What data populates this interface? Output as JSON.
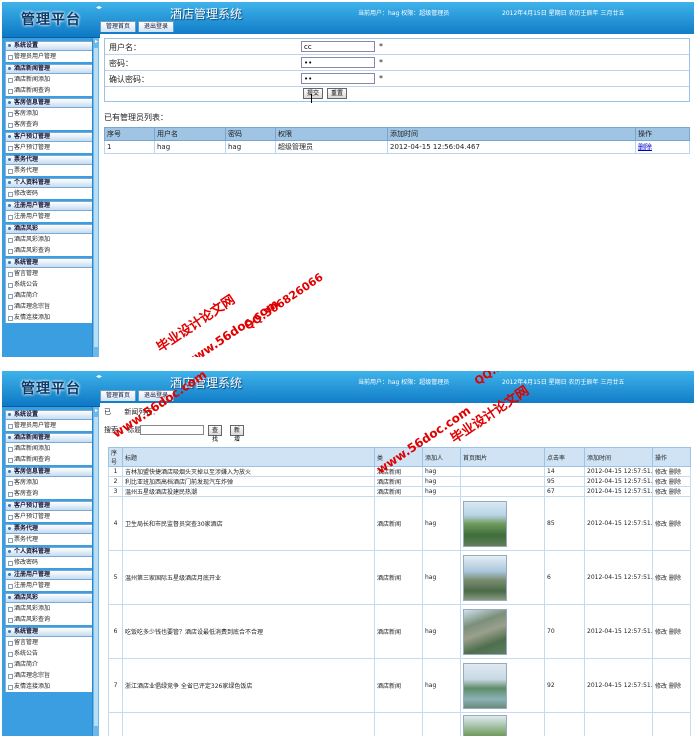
{
  "header": {
    "logo": "管理平台",
    "system_title": "酒店管理系统",
    "user_info": "当前用户：hag 权限：超级管理员",
    "date": "2012年4月15日 星期日 农历壬辰年 三月廿五",
    "collapse_glyph": "◂▸"
  },
  "tabs1": [
    "管理首页",
    "退出登录"
  ],
  "tabs2": [
    "管理首页",
    "退出登录"
  ],
  "sidebar1": [
    {
      "title": "系统设置",
      "items": [
        "管理员用户管理"
      ]
    },
    {
      "title": "酒店新闻管理",
      "items": [
        "酒店新闻添加",
        "酒店新闻查询"
      ]
    },
    {
      "title": "客房信息管理",
      "items": [
        "客房添加",
        "客房查询"
      ]
    },
    {
      "title": "客户预订管理",
      "items": [
        "客户预订管理"
      ]
    },
    {
      "title": "票务代理",
      "items": [
        "票务代理"
      ]
    },
    {
      "title": "个人资料管理",
      "items": [
        "修改密码"
      ]
    },
    {
      "title": "注册用户管理",
      "items": [
        "注册用户管理"
      ]
    },
    {
      "title": "酒店风彩",
      "items": [
        "酒店风彩添加",
        "酒店风彩查询"
      ]
    },
    {
      "title": "系统管理",
      "items": [
        "留言管理",
        "系统公告",
        "酒店简介",
        "酒店理念宗旨",
        "友情连接添加"
      ]
    }
  ],
  "sidebar2": [
    {
      "title": "系统设置",
      "items": [
        "管理员用户管理"
      ]
    },
    {
      "title": "酒店新闻管理",
      "items": [
        "酒店新闻添加",
        "酒店新闻查询"
      ]
    },
    {
      "title": "客房信息管理",
      "items": [
        "客房添加",
        "客房查询"
      ]
    },
    {
      "title": "客户预订管理",
      "items": [
        "客户预订管理"
      ]
    },
    {
      "title": "票务代理",
      "items": [
        "票务代理"
      ]
    },
    {
      "title": "个人资料管理",
      "items": [
        "修改密码"
      ]
    },
    {
      "title": "注册用户管理",
      "items": [
        "注册用户管理"
      ]
    },
    {
      "title": "酒店风彩",
      "items": [
        "酒店风彩添加",
        "酒店风彩查询"
      ]
    },
    {
      "title": "系统管理",
      "items": [
        "留言管理",
        "系统公告",
        "酒店简介",
        "酒店理念宗旨",
        "友情连接添加"
      ]
    }
  ],
  "admin_form": {
    "username_label": "用户名：",
    "username_value": "cc",
    "password_label": "密码：",
    "password_value": "••",
    "confirm_label": "确认密码：",
    "confirm_value": "••",
    "required_mark": "*",
    "submit_label": "提交",
    "reset_label": "重置"
  },
  "admin_list": {
    "title": "已有管理员列表：",
    "headers": [
      "序号",
      "用户名",
      "密码",
      "权限",
      "添加时间",
      "操作"
    ],
    "rows": [
      {
        "no": "1",
        "username": "hag",
        "password": "hag",
        "role": "超级管理员",
        "time": "2012-04-15 12:56:04.467",
        "action": "删除"
      }
    ]
  },
  "news_list": {
    "caption_prefix": "已",
    "caption_suffix": "新闻列表：",
    "search_label": "搜索：",
    "title_label": "标题：",
    "search_button": "查找",
    "add_button": "新增",
    "headers": [
      "序号",
      "标题",
      "类",
      "添加人",
      "首页图片",
      "点击率",
      "添加时间",
      "操作"
    ],
    "edit_label": "修改",
    "delete_label": "删除",
    "rows": [
      {
        "no": "1",
        "title": "吉林加盟快捷酒店吸烟头灭掉以至涉嫌入为放火",
        "type": "酒店新闻",
        "by": "hag",
        "img": "",
        "clicks": "14",
        "time": "2012-04-15 12:57:51.28"
      },
      {
        "no": "2",
        "title": "利比亚班加西高档酒店门前发现汽车炸弹",
        "type": "酒店新闻",
        "by": "hag",
        "img": "",
        "clicks": "95",
        "time": "2012-04-15 12:57:51.263"
      },
      {
        "no": "3",
        "title": "温州五星级酒店投建民热潮",
        "type": "酒店新闻",
        "by": "hag",
        "img": "",
        "clicks": "67",
        "time": "2012-04-15 12:57:51.263"
      },
      {
        "no": "4",
        "title": "卫生局长和市民监督员突查30家酒店",
        "type": "酒店新闻",
        "by": "hag",
        "img": "t1",
        "clicks": "85",
        "time": "2012-04-15 12:57:51.263"
      },
      {
        "no": "5",
        "title": "温州第三家国际五星级酒店月底开业",
        "type": "酒店新闻",
        "by": "hag",
        "img": "t2",
        "clicks": "6",
        "time": "2012-04-15 12:57:51.263"
      },
      {
        "no": "6",
        "title": "吃饭吃多少钱也要管？酒店设最低消费到底合不合理",
        "type": "酒店新闻",
        "by": "hag",
        "img": "t3",
        "clicks": "70",
        "time": "2012-04-15 12:57:51.263"
      },
      {
        "no": "7",
        "title": "浙江酒店业倡绿竞争 全省已评定326家绿色饭店",
        "type": "酒店新闻",
        "by": "hag",
        "img": "t4",
        "clicks": "92",
        "time": "2012-04-15 12:57:51.247"
      },
      {
        "no": "",
        "title": "",
        "type": "",
        "by": "",
        "img": "t5",
        "clicks": "",
        "time": ""
      }
    ]
  },
  "watermark": {
    "site": "www.56doc.com",
    "name": "毕业设计论文网",
    "qq": "QQ:306826066"
  }
}
